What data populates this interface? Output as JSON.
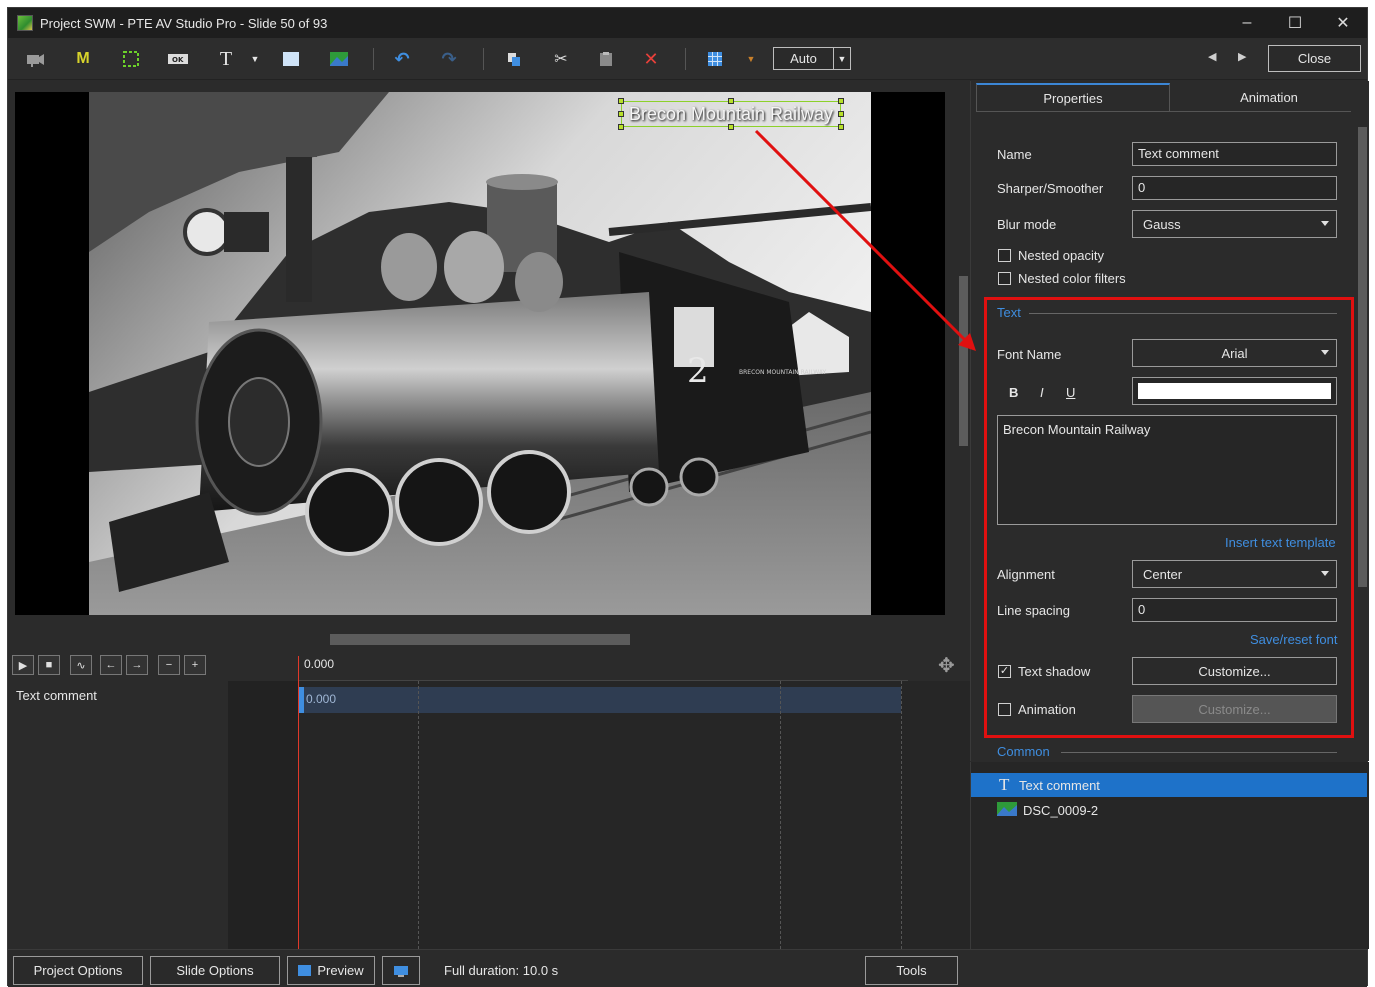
{
  "window": {
    "title": "Project SWM - PTE AV Studio Pro - Slide 50 of 93"
  },
  "toolbar": {
    "auto_label": "Auto",
    "close_label": "Close",
    "icons": [
      "camera-icon",
      "mask-icon",
      "frame-icon",
      "button-icon",
      "text-icon",
      "dropdown-icon",
      "rectangle-icon",
      "image-icon",
      "undo-icon",
      "redo-icon",
      "copy-icon",
      "cut-icon",
      "paste-icon",
      "delete-icon",
      "grid-icon",
      "grid-dropdown-icon"
    ]
  },
  "stage": {
    "selected_text": "Brecon Mountain Railway",
    "photo_locomotive_number": "2",
    "photo_tender_lettering": "BRECON MOUNTAIN RAILWAY"
  },
  "timeline": {
    "ruler_time": "0.000",
    "track_name": "Text comment",
    "clip_time": "0.000"
  },
  "properties": {
    "tabs": [
      {
        "label": "Properties"
      },
      {
        "label": "Animation"
      }
    ],
    "name_label": "Name",
    "name_value": "Text comment",
    "sharper_label": "Sharper/Smoother",
    "sharper_value": "0",
    "blur_label": "Blur mode",
    "blur_value": "Gauss",
    "nested_opacity_label": "Nested opacity",
    "nested_color_label": "Nested color filters",
    "text_section": "Text",
    "font_name_label": "Font Name",
    "font_name_value": "Arial",
    "bold_label": "B",
    "italic_label": "I",
    "underline_label": "U",
    "text_value": "Brecon Mountain Railway",
    "insert_template_label": "Insert text template",
    "alignment_label": "Alignment",
    "alignment_value": "Center",
    "line_spacing_label": "Line spacing",
    "line_spacing_value": "0",
    "save_reset_label": "Save/reset font",
    "text_shadow_label": "Text shadow",
    "text_shadow_checked": "✓",
    "customize_label": "Customize...",
    "animation_label": "Animation",
    "customize_disabled_label": "Customize...",
    "common_section": "Common",
    "colors": {
      "accent": "#3f8ee0",
      "highlight": "#e01010",
      "selection": "#1e72c9"
    }
  },
  "objects": [
    {
      "icon": "T",
      "label": "Text comment"
    },
    {
      "icon": "",
      "label": "DSC_0009-2"
    }
  ],
  "status": {
    "project_options": "Project Options",
    "slide_options": "Slide Options",
    "preview": "Preview",
    "full_duration": "Full duration: 10.0 s",
    "tools": "Tools"
  }
}
